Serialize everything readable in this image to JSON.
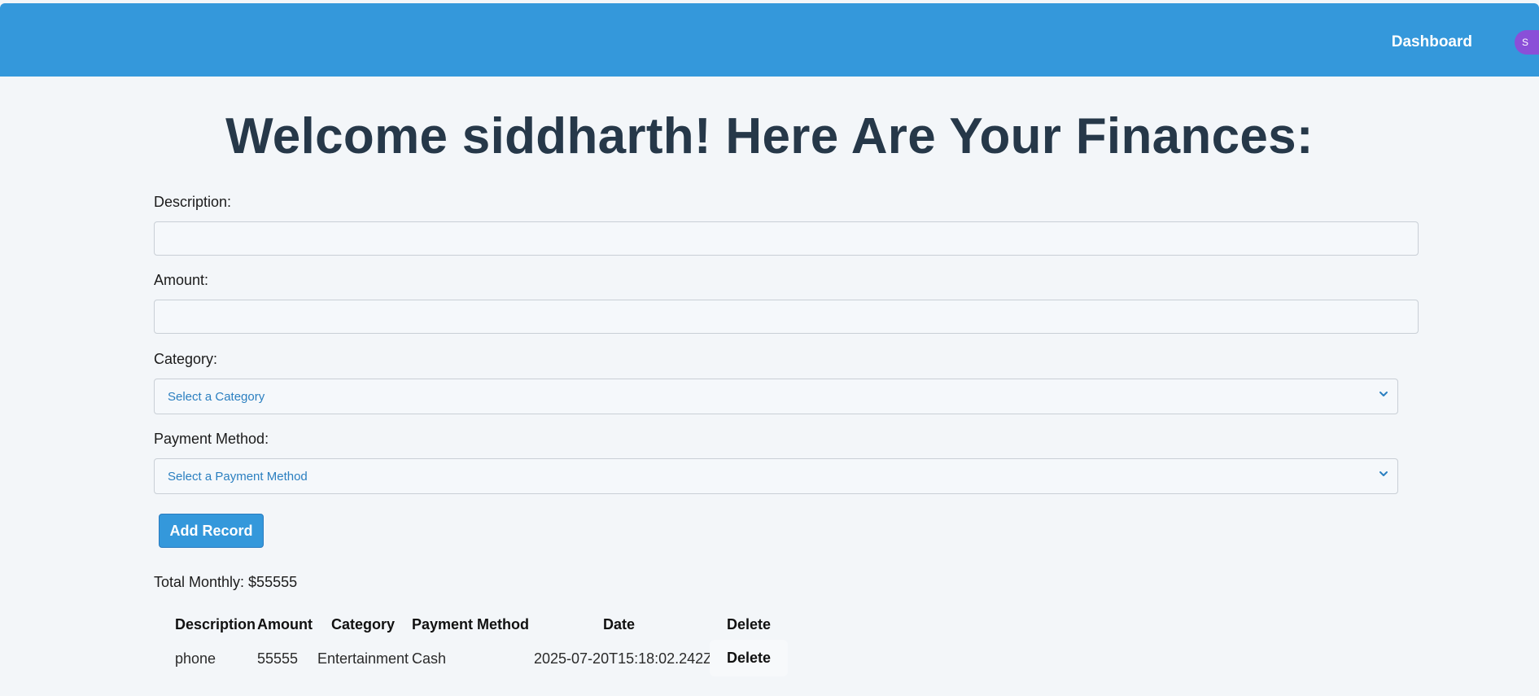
{
  "header": {
    "nav_link": "Dashboard",
    "avatar_initial": "S",
    "bg_color": "#3498db"
  },
  "page": {
    "title": "Welcome siddharth! Here Are Your Finances:"
  },
  "form": {
    "description_label": "Description:",
    "description_value": "",
    "amount_label": "Amount:",
    "amount_value": "",
    "category_label": "Category:",
    "category_selected": "Select a Category",
    "payment_label": "Payment Method:",
    "payment_selected": "Select a Payment Method",
    "submit_label": "Add Record"
  },
  "summary": {
    "total_text": "Total Monthly: $55555"
  },
  "table": {
    "headers": [
      "Description",
      "Amount",
      "Category",
      "Payment Method",
      "Date",
      "Delete"
    ],
    "rows": [
      {
        "description": "phone",
        "amount": "55555",
        "category": "Entertainment",
        "payment_method": "Cash",
        "date": "2025-07-20T15:18:02.242Z",
        "delete_label": "Delete"
      }
    ]
  },
  "icons": {
    "select_chevron": "chevron-down-icon"
  }
}
